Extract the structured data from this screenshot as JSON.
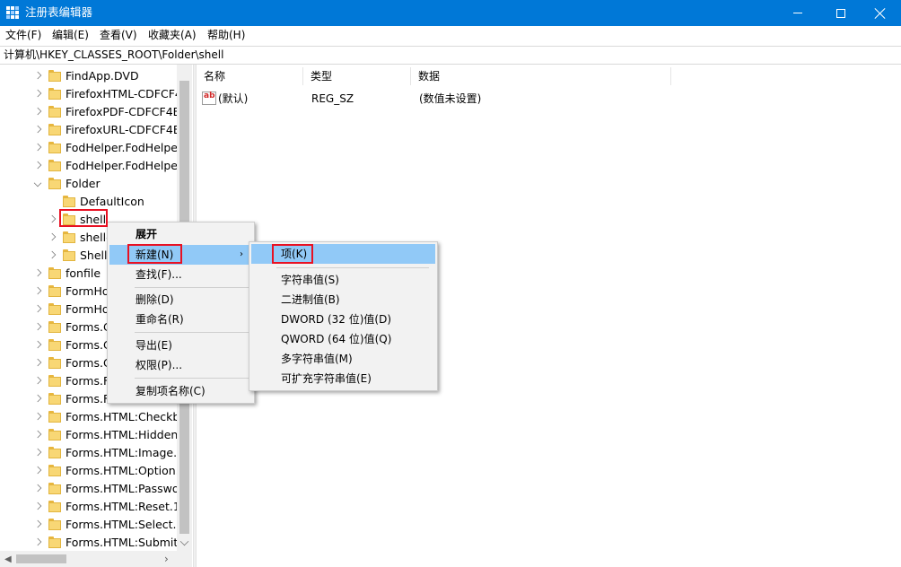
{
  "window": {
    "title": "注册表编辑器",
    "controls": {
      "minimize": "minimize",
      "maximize": "maximize",
      "close": "close"
    }
  },
  "menubar": [
    {
      "label": "文件(F)"
    },
    {
      "label": "编辑(E)"
    },
    {
      "label": "查看(V)"
    },
    {
      "label": "收藏夹(A)"
    },
    {
      "label": "帮助(H)"
    }
  ],
  "address": {
    "path": "计算机\\HKEY_CLASSES_ROOT\\Folder\\shell"
  },
  "tree": {
    "items": [
      {
        "label": "FindApp.DVD",
        "expander": "collapsed",
        "level": 0
      },
      {
        "label": "FirefoxHTML-CDFCF4",
        "expander": "collapsed",
        "level": 0
      },
      {
        "label": "FirefoxPDF-CDFCF4B7",
        "expander": "collapsed",
        "level": 0
      },
      {
        "label": "FirefoxURL-CDFCF4B7",
        "expander": "collapsed",
        "level": 0
      },
      {
        "label": "FodHelper.FodHelper",
        "expander": "collapsed",
        "level": 0
      },
      {
        "label": "FodHelper.FodHelper",
        "expander": "collapsed",
        "level": 0
      },
      {
        "label": "Folder",
        "expander": "expanded",
        "level": 0
      },
      {
        "label": "DefaultIcon",
        "expander": "none",
        "level": 1
      },
      {
        "label": "shell",
        "expander": "collapsed",
        "level": 1,
        "selected": true
      },
      {
        "label": "shelle",
        "expander": "collapsed",
        "level": 1
      },
      {
        "label": "Shell",
        "expander": "collapsed",
        "level": 1
      },
      {
        "label": "fonfile",
        "expander": "collapsed",
        "level": 0
      },
      {
        "label": "FormHo",
        "expander": "collapsed",
        "level": 0
      },
      {
        "label": "FormHo",
        "expander": "collapsed",
        "level": 0
      },
      {
        "label": "Forms.C",
        "expander": "collapsed",
        "level": 0
      },
      {
        "label": "Forms.C",
        "expander": "collapsed",
        "level": 0
      },
      {
        "label": "Forms.C",
        "expander": "collapsed",
        "level": 0
      },
      {
        "label": "Forms.F",
        "expander": "collapsed",
        "level": 0
      },
      {
        "label": "Forms.F",
        "expander": "collapsed",
        "level": 0
      },
      {
        "label": "Forms.HTML:Checkbo",
        "expander": "collapsed",
        "level": 0
      },
      {
        "label": "Forms.HTML:Hidden.",
        "expander": "collapsed",
        "level": 0
      },
      {
        "label": "Forms.HTML:Image.1",
        "expander": "collapsed",
        "level": 0
      },
      {
        "label": "Forms.HTML:Option.1",
        "expander": "collapsed",
        "level": 0
      },
      {
        "label": "Forms.HTML:Passwor",
        "expander": "collapsed",
        "level": 0
      },
      {
        "label": "Forms.HTML:Reset.1",
        "expander": "collapsed",
        "level": 0
      },
      {
        "label": "Forms.HTML:Select.1",
        "expander": "collapsed",
        "level": 0
      },
      {
        "label": "Forms.HTML:Submitb",
        "expander": "collapsed",
        "level": 0
      }
    ]
  },
  "values": {
    "columns": [
      {
        "label": "名称"
      },
      {
        "label": "类型"
      },
      {
        "label": "数据"
      }
    ],
    "rows": [
      {
        "icon": "string-value-icon",
        "icon_text": "ab",
        "name": "(默认)",
        "type": "REG_SZ",
        "data": "(数值未设置)"
      }
    ]
  },
  "context_menu": {
    "items": [
      {
        "label": "展开",
        "bold": true
      },
      {
        "label": "新建(N)",
        "highlighted": true,
        "has_submenu": true,
        "submenu_arrow": "›"
      },
      {
        "label": "查找(F)..."
      },
      {
        "label": "删除(D)"
      },
      {
        "label": "重命名(R)"
      },
      {
        "label": "导出(E)"
      },
      {
        "label": "权限(P)..."
      },
      {
        "label": "复制项名称(C)"
      }
    ]
  },
  "submenu": {
    "items": [
      {
        "label": "项(K)",
        "highlighted": true
      },
      {
        "label": "字符串值(S)"
      },
      {
        "label": "二进制值(B)"
      },
      {
        "label": "DWORD (32 位)值(D)"
      },
      {
        "label": "QWORD (64 位)值(Q)"
      },
      {
        "label": "多字符串值(M)"
      },
      {
        "label": "可扩充字符串值(E)"
      }
    ]
  },
  "colors": {
    "titlebar": "#0078d7",
    "menu_highlight": "#91c9f7",
    "annotation_red": "#e81123",
    "folder_yellow": "#f8d775"
  }
}
